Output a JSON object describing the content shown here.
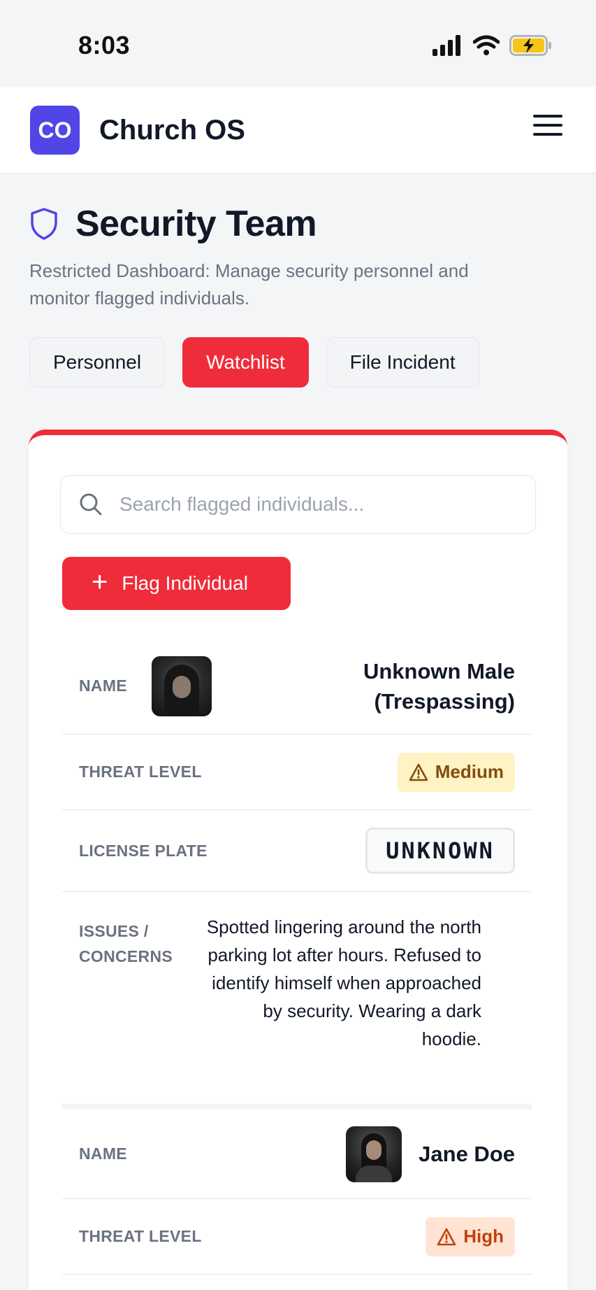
{
  "status_bar": {
    "time": "8:03"
  },
  "app": {
    "logo_text": "CO",
    "name": "Church OS"
  },
  "page": {
    "title": "Security Team",
    "subtitle": "Restricted Dashboard: Manage security personnel and monitor flagged individuals."
  },
  "tabs": [
    {
      "label": "Personnel",
      "active": false
    },
    {
      "label": "Watchlist",
      "active": true
    },
    {
      "label": "File Incident",
      "active": false
    }
  ],
  "search": {
    "placeholder": "Search flagged individuals..."
  },
  "flag_button": {
    "label": "Flag Individual"
  },
  "individuals": [
    {
      "name_label": "NAME",
      "name": "Unknown Male (Trespassing)",
      "threat_label": "THREAT LEVEL",
      "threat_level": "Medium",
      "plate_label": "LICENSE PLATE",
      "plate": "UNKNOWN",
      "issues_label": "ISSUES / CONCERNS",
      "issues": "Spotted lingering around the north parking lot after hours. Refused to identify himself when approached by security. Wearing a dark hoodie."
    },
    {
      "name_label": "NAME",
      "name": "Jane Doe",
      "threat_label": "THREAT LEVEL",
      "threat_level": "High"
    }
  ],
  "colors": {
    "accent_red": "#ef2d3a",
    "brand_indigo": "#4f46e5",
    "medium_badge_bg": "#fdf3c4",
    "medium_badge_fg": "#854d0e",
    "high_badge_bg": "#ffe4d4",
    "high_badge_fg": "#c2410c"
  },
  "icons": {
    "signal": "signal-icon",
    "wifi": "wifi-icon",
    "battery": "battery-charging-icon",
    "menu": "hamburger-menu-icon",
    "shield": "shield-icon",
    "search": "search-icon",
    "plus": "plus-icon",
    "warning": "warning-triangle-icon"
  }
}
